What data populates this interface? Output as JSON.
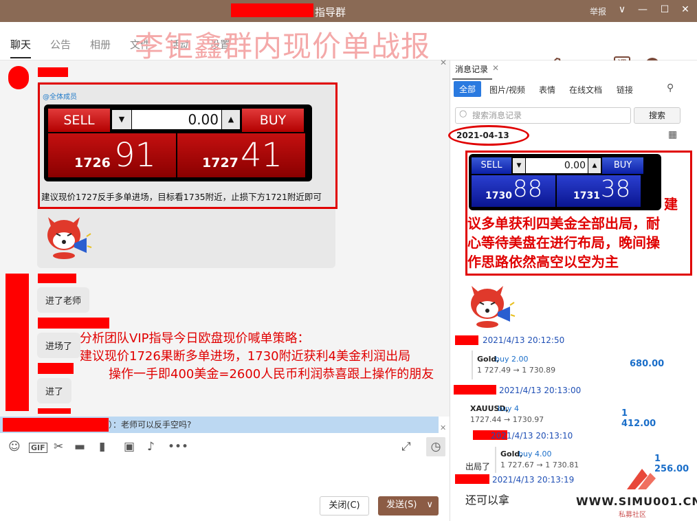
{
  "window": {
    "title": "指导群",
    "report_label": "举报",
    "min": "—",
    "max": "☐",
    "close": "✕",
    "dropdown": "∨"
  },
  "tabs": [
    "聊天",
    "公告",
    "相册",
    "文件",
    "活动",
    "设置"
  ],
  "overlay_title": "李钜鑫群内现价单战报",
  "chat": {
    "at_all": "@全体成员",
    "trade1": {
      "sell": "SELL",
      "buy": "BUY",
      "value": "0.00",
      "sell_small": "1726",
      "sell_big": "91",
      "buy_small": "1727",
      "buy_big": "41"
    },
    "advice": "建议现价1727反手多单进场，目标看1735附近，止损下方1721附近即可",
    "msg1": "进了老师",
    "msg2": "进场了",
    "msg3": "进了",
    "red_text": [
      "分析团队VIP指导今日欧盘现价喊单策略：",
      "建议现价1726果断多单进场，1730附近获利4美金利润出局",
      "操作一手即400美金=2600人民币利润恭喜跟上操作的朋友"
    ],
    "quote": "）：老师可以反手空吗?"
  },
  "input": {
    "close_button": "关闭(C)",
    "send_button": "发送(S)"
  },
  "history": {
    "title": "消息记录",
    "close": "✕",
    "tabs": [
      "全部",
      "图片/视频",
      "表情",
      "在线文档",
      "链接"
    ],
    "search_placeholder": "搜索消息记录",
    "search_button": "搜索",
    "date": "2021-04-13",
    "trade2": {
      "sell": "SELL",
      "buy": "BUY",
      "value": "0.00",
      "sell_small": "1730",
      "sell_big": "88",
      "buy_small": "1731",
      "buy_big": "38"
    },
    "red_text": [
      "建",
      "议多单获利四美金全部出局，耐",
      "心等待美盘在进行布局，晚间操",
      "作思路依然高空以空为主"
    ],
    "entries": [
      {
        "time": "2021/4/13 20:12:50",
        "symbol": "Gold,",
        "action": "buy 2.00",
        "prices": "1 727.49 → 1 730.89",
        "value": "680.00"
      },
      {
        "time": "2021/4/13 20:13:00",
        "symbol": "XAUUSD,",
        "action": "buy 4",
        "prices": "1727.44 → 1730.97",
        "value": "1 412.00"
      },
      {
        "time": "2021/4/13 20:13:10",
        "symbol": "Gold,",
        "action": "buy 4.00",
        "prices": "1 727.67 → 1 730.81",
        "value": "1 256.00",
        "prefix": "出局了"
      },
      {
        "time": "2021/4/13 20:13:19",
        "text": "还可以拿"
      }
    ],
    "watermark": "WWW.SIMU001.CN",
    "watermark_sub": "私募社区"
  }
}
